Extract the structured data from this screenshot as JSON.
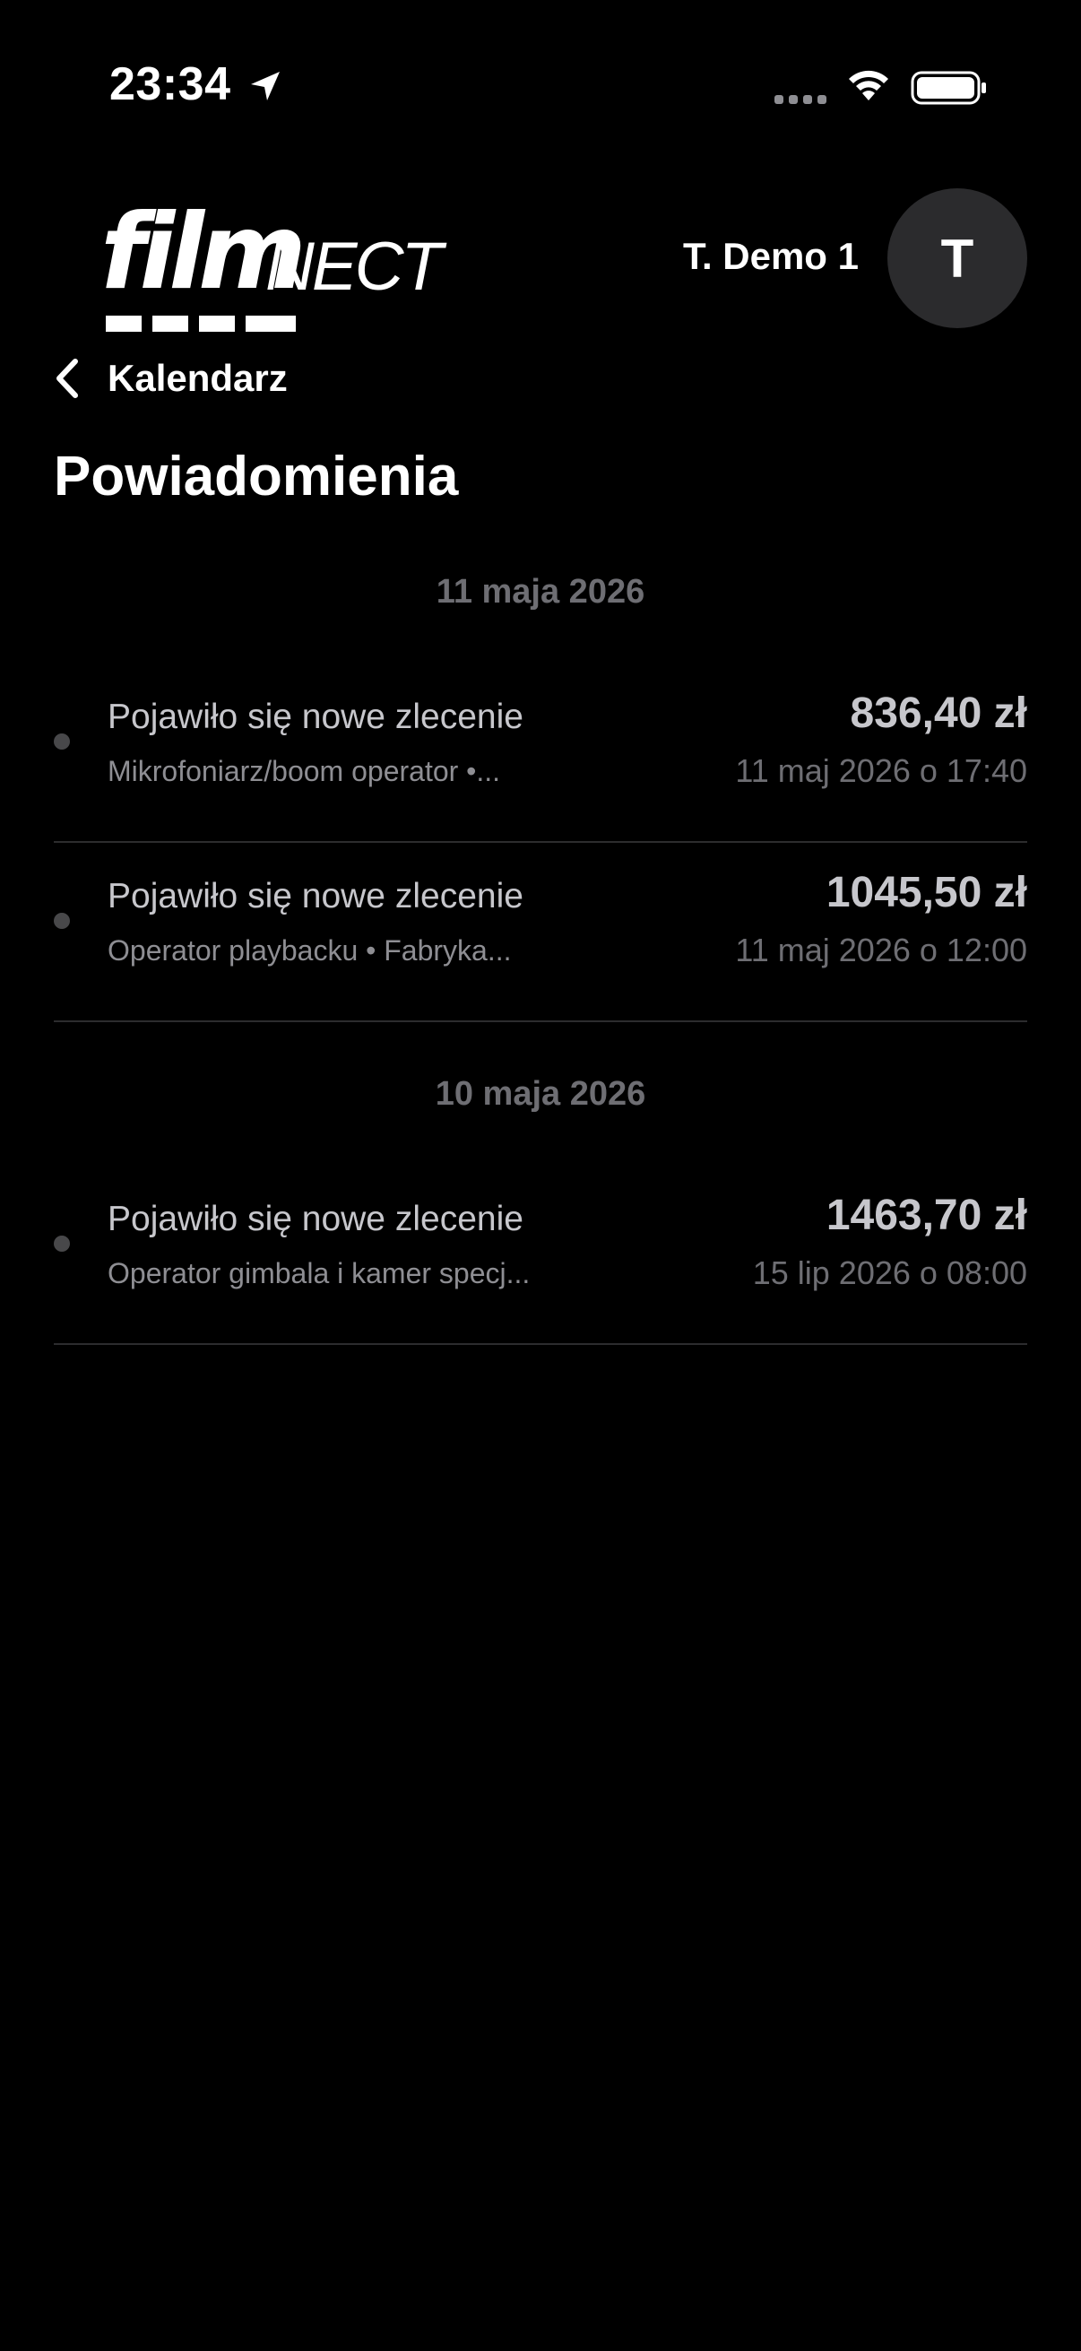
{
  "status_bar": {
    "time": "23:34",
    "icons": [
      "location-arrow-icon",
      "cellular-signal-icon",
      "wifi-icon",
      "battery-icon"
    ]
  },
  "header": {
    "logo_bold": "film",
    "logo_light": "NECT",
    "user_name": "T. Demo 1",
    "avatar_initial": "T"
  },
  "nav": {
    "back_label": "Kalendarz",
    "back_icon": "chevron-left-icon"
  },
  "page": {
    "title": "Powiadomienia"
  },
  "colors": {
    "background": "#000000",
    "date_header": "#6e6e73",
    "divider": "#2c2c2e",
    "avatar_bg": "#2b2b2d"
  },
  "groups": [
    {
      "date": "11 maja 2026",
      "items": [
        {
          "title": "Pojawiło się nowe zlecenie",
          "subtitle": "Mikrofoniarz/boom operator •...",
          "amount": "836,40 zł",
          "datetime": "11 maj 2026 o 17:40"
        },
        {
          "title": "Pojawiło się nowe zlecenie",
          "subtitle": "Operator playbacku • Fabryka...",
          "amount": "1045,50 zł",
          "datetime": "11 maj 2026 o 12:00"
        }
      ]
    },
    {
      "date": "10 maja 2026",
      "items": [
        {
          "title": "Pojawiło się nowe zlecenie",
          "subtitle": "Operator gimbala i kamer specj...",
          "amount": "1463,70 zł",
          "datetime": "15 lip 2026 o 08:00"
        }
      ]
    }
  ]
}
